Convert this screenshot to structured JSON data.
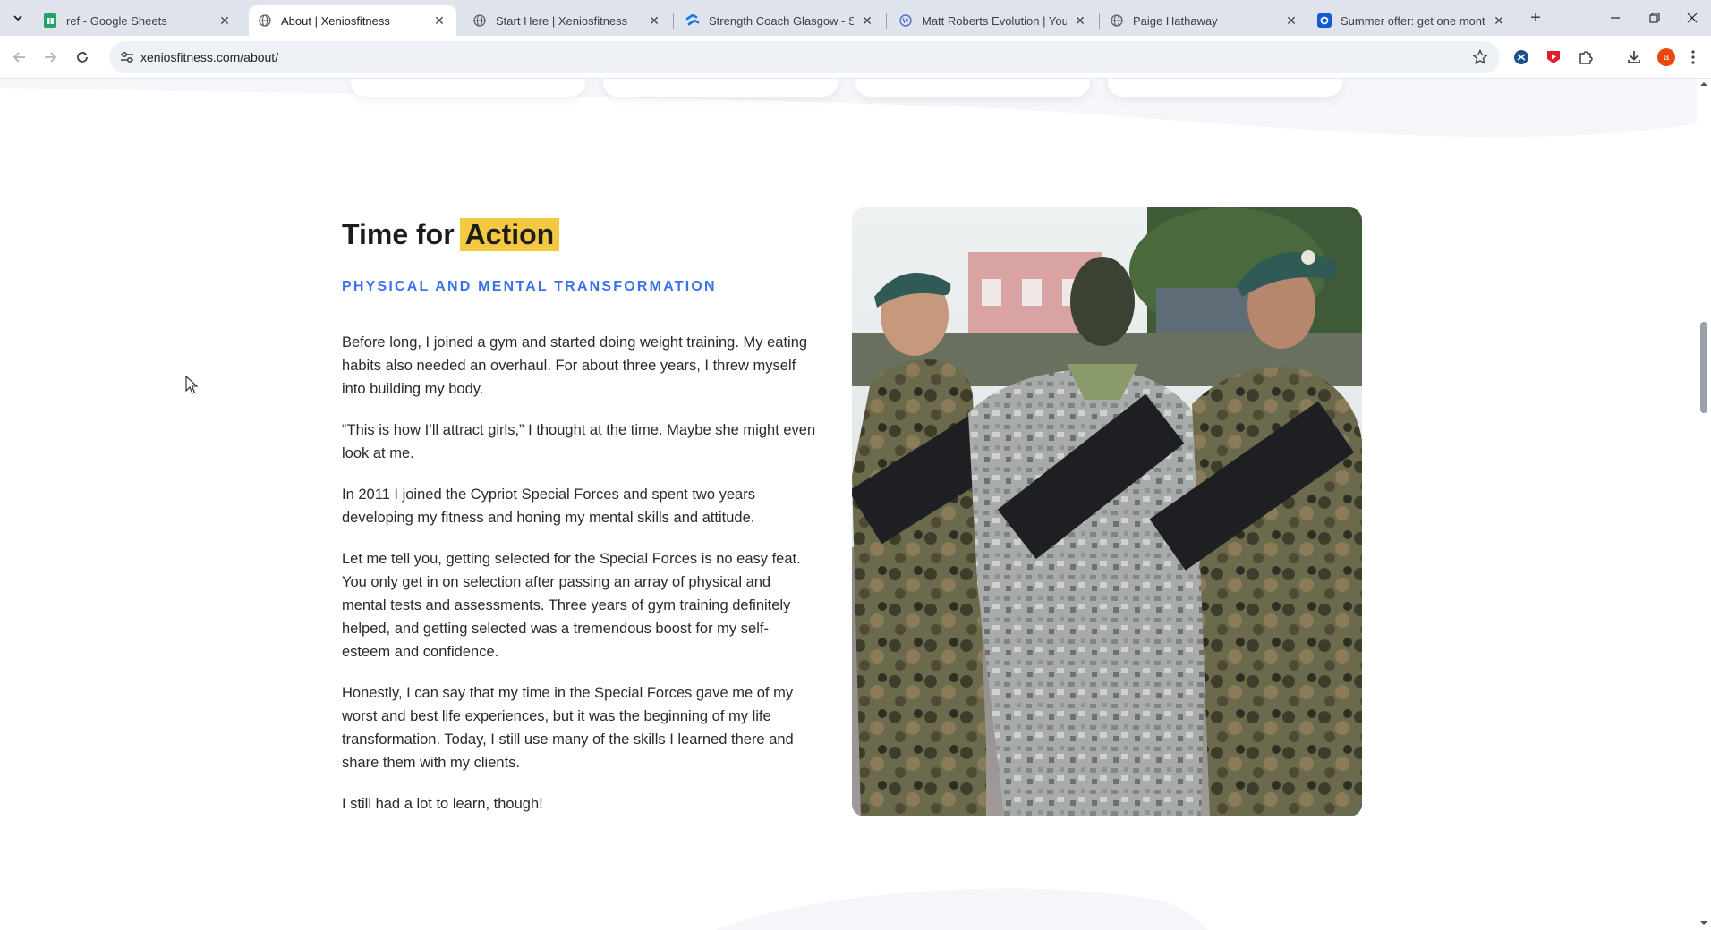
{
  "browser": {
    "tabs": [
      {
        "title": "ref - Google Sheets",
        "icon": "google-sheets-icon",
        "active": false
      },
      {
        "title": "About | Xeniosfitness",
        "icon": "globe-icon",
        "active": true
      },
      {
        "title": "Start Here | Xeniosfitness",
        "icon": "globe-icon",
        "active": false
      },
      {
        "title": "Strength Coach Glasgow - Simp",
        "icon": "squarespace-icon",
        "active": false
      },
      {
        "title": "Matt Roberts Evolution | Young",
        "icon": "wordpress-icon",
        "active": false
      },
      {
        "title": "Paige Hathaway",
        "icon": "globe-icon",
        "active": false
      },
      {
        "title": "Summer offer: get one month f",
        "icon": "offer-site-icon",
        "active": false
      }
    ],
    "url": "xeniosfitness.com/about/",
    "profile_initial": "a",
    "accent": "#3a73e8"
  },
  "section": {
    "heading_prefix": "Time for",
    "heading_highlight": "Action",
    "subheading": "PHYSICAL AND MENTAL TRANSFORMATION",
    "paragraphs": [
      "Before long, I joined a gym and started doing weight training. My eating habits also needed an overhaul. For about three years, I threw myself into building my body.",
      "“This is how I’ll attract girls,” I thought at the time. Maybe she might even look at me.",
      "In 2011 I joined the Cypriot Special Forces and spent two years developing my fitness and honing my mental skills and attitude.",
      "Let me tell you, getting selected for the Special Forces is no easy feat. You only get in on selection after passing an array of physical and mental tests and assessments. Three years of gym training definitely helped, and getting selected was a tremendous boost for my self-esteem and confidence.",
      "Honestly, I can say that my time in the Special Forces gave me of my worst and best life experiences, but it was the beginning of my life transformation. Today, I still use many of the skills I learned there and share them with my clients.",
      "I still had a lot to learn, though!"
    ],
    "highlight_color": "#f5c842",
    "subheading_color": "#3a73e8"
  }
}
